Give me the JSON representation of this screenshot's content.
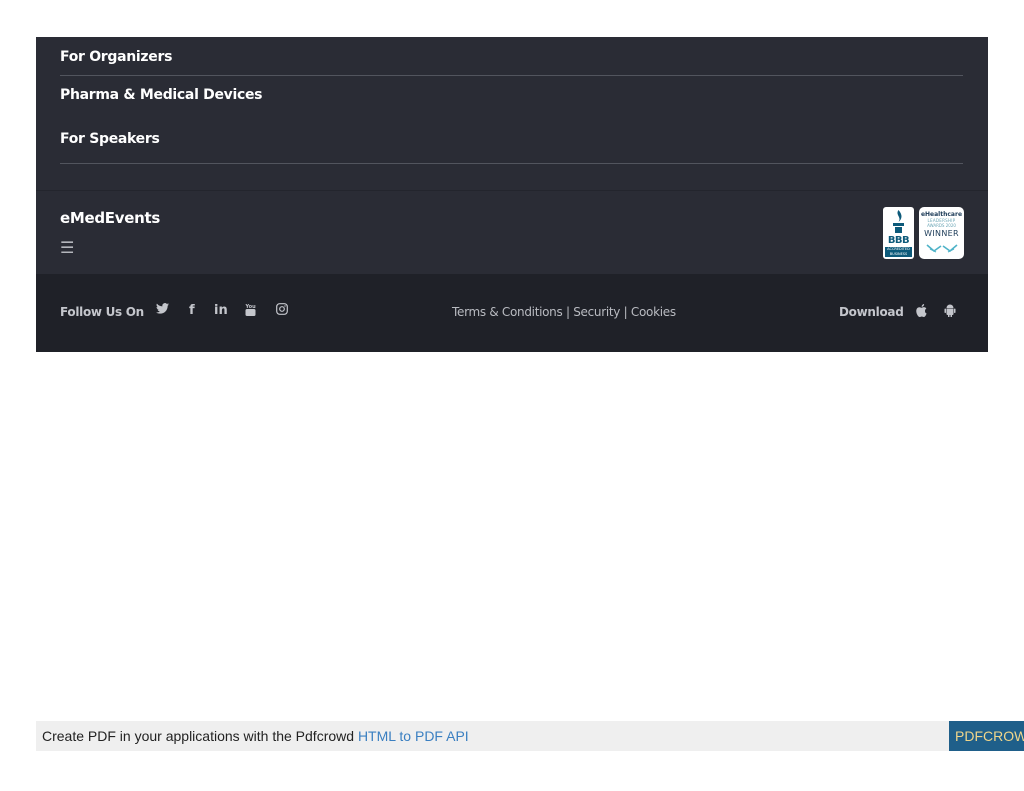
{
  "footer_menu": {
    "for_organizers": "For Organizers",
    "pharma": "Pharma & Medical Devices",
    "for_speakers": "For Speakers"
  },
  "brand": {
    "name": "eMedEvents",
    "menu_glyph": "☰",
    "bbb_text": "BBB",
    "bbb_sub": "ACCREDITED BUSINESS",
    "award_line1": "eHealthcare",
    "award_line2": "LEADERSHIP",
    "award_line3": "AWARDS 2020",
    "award_line4": "WINNER"
  },
  "social": {
    "label": "Follow Us On",
    "twitter": "🐦",
    "facebook": "f",
    "linkedin": "in",
    "youtube": "▶",
    "instagram": "◎"
  },
  "legal": {
    "terms": "Terms & Conditions",
    "sep1": " | ",
    "security": "Security",
    "sep2": " | ",
    "cookies": "Cookies"
  },
  "download": {
    "label": "Download",
    "apple": "",
    "android": "🤖"
  },
  "pdf_bar": {
    "text": "Create PDF in your applications with the Pdfcrowd ",
    "link": "HTML to PDF API",
    "brand": "PDFCROWD"
  },
  "colors": {
    "footer_bg": "#2a2c35",
    "footer_bottom_bg": "#1f2128",
    "link_blue": "#3a7fc1"
  }
}
